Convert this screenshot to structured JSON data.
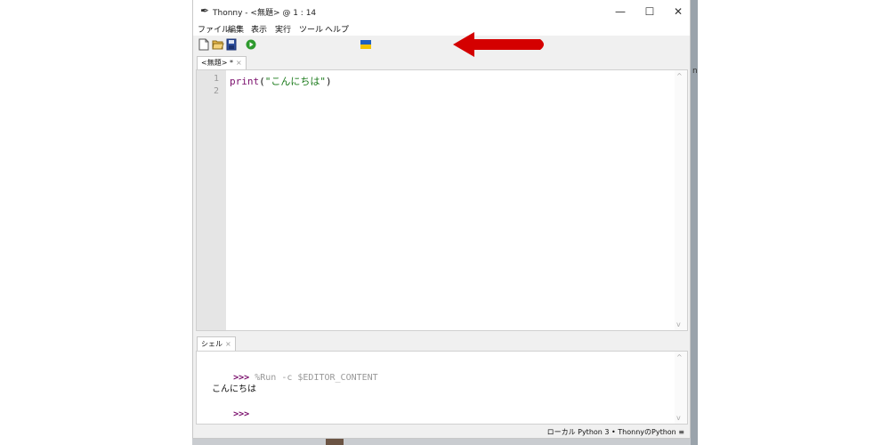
{
  "window": {
    "title": "Thonny - <無題> @ 1 : 14",
    "minimize": "—",
    "maximize": "☐",
    "close": "✕"
  },
  "menu": [
    "ファイル",
    "編集",
    "表示",
    "実行",
    "ツール",
    "ヘルプ"
  ],
  "toolbar": {
    "icons": [
      "new-file-icon",
      "open-file-icon",
      "save-icon",
      "run-icon",
      "ukraine-flag-icon"
    ]
  },
  "editor": {
    "tab_label": "<無題> *",
    "tab_close": "×",
    "line_numbers": [
      "1",
      "2"
    ],
    "code_func": "print",
    "code_open": "(",
    "code_string": "\"こんにちは\"",
    "code_close": ")"
  },
  "shell": {
    "tab_label": "シェル",
    "tab_close": "×",
    "prompt1": ">>>",
    "command": "%Run -c $EDITOR_CONTENT",
    "output": "こんにちは",
    "prompt2": ">>>"
  },
  "status": {
    "text": "ローカル Python 3 • ThonnyのPython  ≡"
  },
  "annotation": {
    "arrow_color": "#d40000"
  },
  "background": {
    "partial_text": "n"
  }
}
